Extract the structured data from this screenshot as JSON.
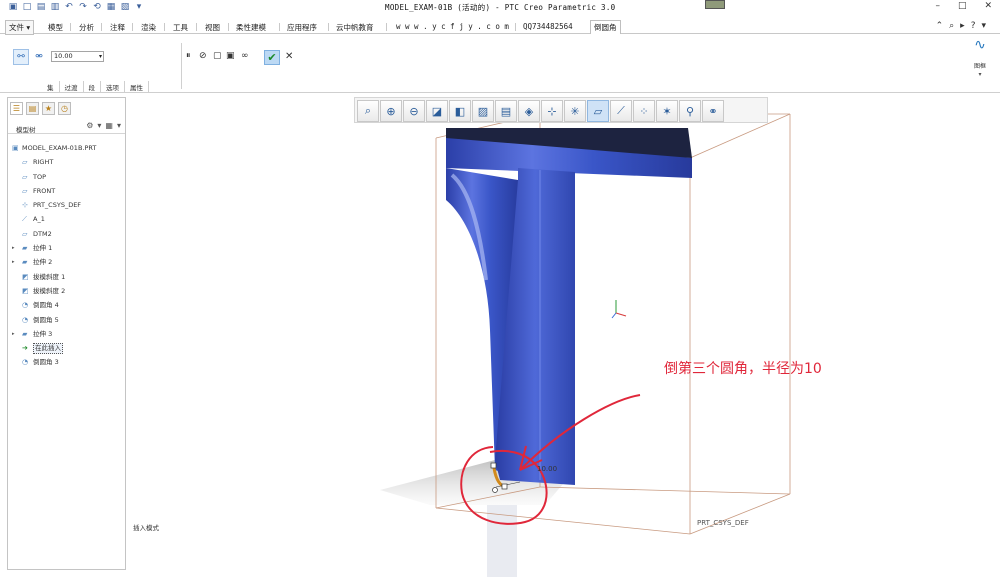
{
  "window": {
    "title": "MODEL_EXAM-01B (活动的) - PTC Creo Parametric 3.0"
  },
  "menu": {
    "file": "文件",
    "tabs": [
      "模型",
      "分析",
      "注释",
      "渲染",
      "工具",
      "视图",
      "柔性建模",
      "应用程序",
      "云中帆教育",
      "w w w . y c f j y . c o m",
      "QQ734482564"
    ],
    "active_tab": "倒圆角"
  },
  "ribbon": {
    "radius_value": "10.00",
    "sub_tabs": [
      "集",
      "过渡",
      "段",
      "选项",
      "属性"
    ],
    "right_panel_label": "图框"
  },
  "sidebar": {
    "tree_title": "模型树",
    "items": [
      {
        "label": "MODEL_EXAM-01B.PRT",
        "icon": "part-icon",
        "expand": false,
        "indent": 0
      },
      {
        "label": "RIGHT",
        "icon": "datum-plane-icon",
        "expand": false,
        "indent": 1
      },
      {
        "label": "TOP",
        "icon": "datum-plane-icon",
        "expand": false,
        "indent": 1
      },
      {
        "label": "FRONT",
        "icon": "datum-plane-icon",
        "expand": false,
        "indent": 1
      },
      {
        "label": "PRT_CSYS_DEF",
        "icon": "csys-icon",
        "expand": false,
        "indent": 1
      },
      {
        "label": "A_1",
        "icon": "axis-icon",
        "expand": false,
        "indent": 1
      },
      {
        "label": "DTM2",
        "icon": "datum-plane-icon",
        "expand": false,
        "indent": 1
      },
      {
        "label": "拉伸 1",
        "icon": "extrude-icon",
        "expand": true,
        "indent": 1
      },
      {
        "label": "拉伸 2",
        "icon": "extrude-icon",
        "expand": true,
        "indent": 1
      },
      {
        "label": "拔模斜度 1",
        "icon": "draft-icon",
        "expand": false,
        "indent": 1
      },
      {
        "label": "拔模斜度 2",
        "icon": "draft-icon",
        "expand": false,
        "indent": 1
      },
      {
        "label": "倒圆角 4",
        "icon": "round-icon",
        "expand": false,
        "indent": 1
      },
      {
        "label": "倒圆角 5",
        "icon": "round-icon",
        "expand": false,
        "indent": 1
      },
      {
        "label": "拉伸 3",
        "icon": "extrude-icon",
        "expand": true,
        "indent": 1
      },
      {
        "label": "在此插入",
        "icon": "insert-arrow-icon",
        "expand": false,
        "indent": 1,
        "boxed": true
      },
      {
        "label": "倒圆角 3",
        "icon": "round-icon",
        "expand": false,
        "indent": 1
      }
    ]
  },
  "status": {
    "text": "插入模式"
  },
  "viewport": {
    "annotation": "倒第三个圆角，半径为10",
    "csys_label": "PRT_CSYS_DEF",
    "dimension": "10.00",
    "colors": {
      "model_blue": "#3a56c8",
      "annotation_red": "#e0273a",
      "round_orange": "#d28a1c"
    }
  }
}
